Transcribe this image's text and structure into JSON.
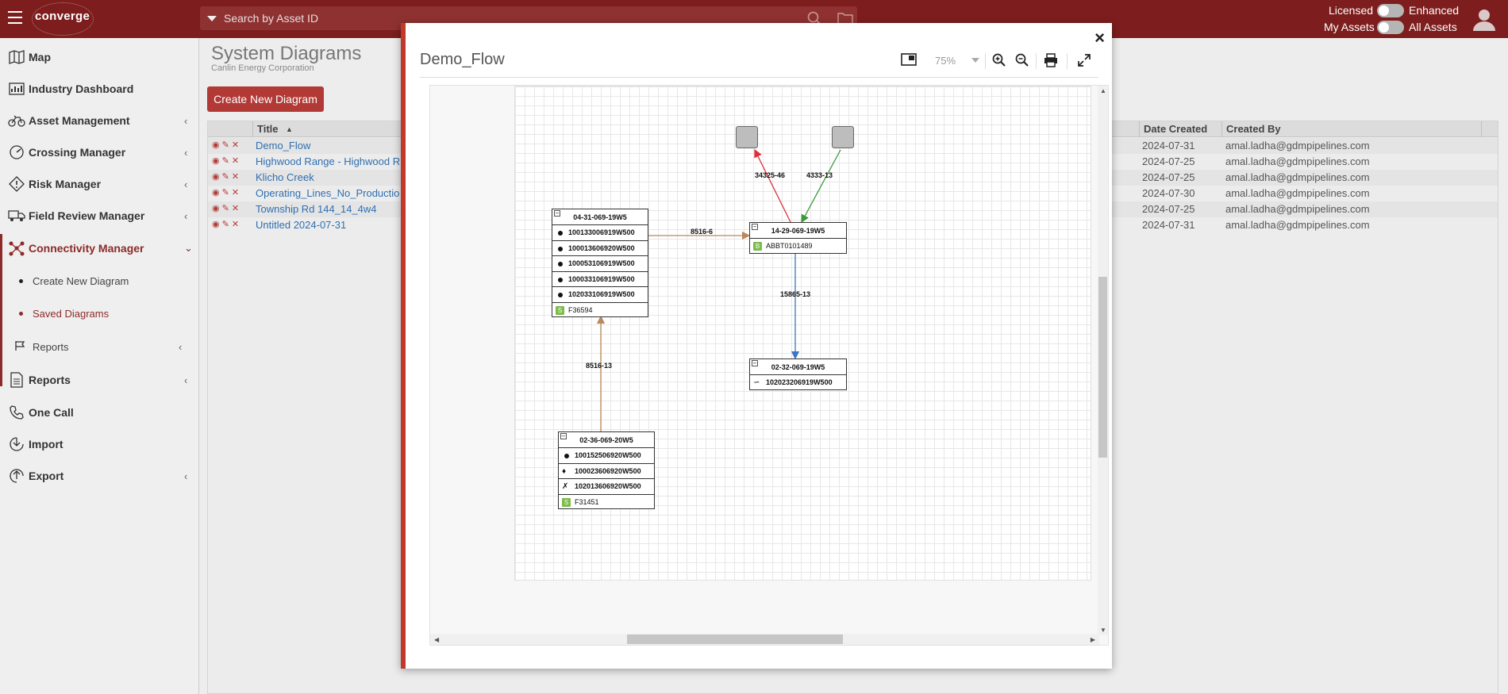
{
  "app": {
    "logo": "converge"
  },
  "search": {
    "placeholder": "Search by Asset ID"
  },
  "topright": {
    "licensed_label": "Licensed",
    "enhanced_label": "Enhanced",
    "my_assets_label": "My Assets",
    "all_assets_label": "All Assets"
  },
  "sidebar": {
    "items": [
      {
        "label": "Map",
        "icon": "map-icon"
      },
      {
        "label": "Industry Dashboard",
        "icon": "dashboard-icon"
      },
      {
        "label": "Asset Management",
        "icon": "bicycle-icon"
      },
      {
        "label": "Crossing Manager",
        "icon": "gauge-icon"
      },
      {
        "label": "Risk Manager",
        "icon": "warning-diamond-icon"
      },
      {
        "label": "Field Review Manager",
        "icon": "truck-icon"
      },
      {
        "label": "Connectivity Manager",
        "icon": "network-icon"
      },
      {
        "label": "Reports",
        "icon": "flag-icon"
      },
      {
        "label": "Reports",
        "icon": "document-icon"
      },
      {
        "label": "One Call",
        "icon": "phone-icon"
      },
      {
        "label": "Import",
        "icon": "import-icon"
      },
      {
        "label": "Export",
        "icon": "export-icon"
      }
    ],
    "subitems": [
      {
        "label": "Create New Diagram"
      },
      {
        "label": "Saved Diagrams"
      }
    ]
  },
  "page": {
    "title": "System Diagrams",
    "subtitle": "Canlin Energy Corporation",
    "create_button": "Create New Diagram"
  },
  "table": {
    "columns": {
      "title": "Title",
      "date_created": "Date Created",
      "created_by": "Created By"
    },
    "rows": [
      {
        "title": "Demo_Flow",
        "date": "2024-07-31",
        "by": "amal.ladha@gdmpipelines.com"
      },
      {
        "title": "Highwood Range - Highwood R",
        "date": "2024-07-25",
        "by": "amal.ladha@gdmpipelines.com"
      },
      {
        "title": "Klicho Creek",
        "date": "2024-07-25",
        "by": "amal.ladha@gdmpipelines.com"
      },
      {
        "title": "Operating_Lines_No_Productio",
        "date": "2024-07-30",
        "by": "amal.ladha@gdmpipelines.com"
      },
      {
        "title": "Township Rd 144_14_4w4",
        "date": "2024-07-25",
        "by": "amal.ladha@gdmpipelines.com"
      },
      {
        "title": "Untitled 2024-07-31",
        "date": "2024-07-31",
        "by": "amal.ladha@gdmpipelines.com"
      }
    ]
  },
  "modal": {
    "title": "Demo_Flow",
    "zoom": "75%",
    "close": "×"
  },
  "diagram": {
    "node_a": {
      "header": "04-31-069-19W5",
      "rows": [
        "100133006919W500",
        "100013606920W500",
        "100053106919W500",
        "100033106919W500",
        "102033106919W500"
      ],
      "footer": "F36594"
    },
    "node_b": {
      "header": "14-29-069-19W5",
      "row": "ABBT0101489"
    },
    "node_c": {
      "header": "02-32-069-19W5",
      "row": "102023206919W500"
    },
    "node_d": {
      "header": "02-36-069-20W5",
      "rows": [
        "100152506920W500",
        "100023606920W500",
        "102013606920W500"
      ],
      "footer": "F31451"
    },
    "edges": {
      "a_to_b": "8516-6",
      "d_to_a": "8516-13",
      "b_to_c": "15865-13",
      "b_to_left": "34325-46",
      "right_to_b": "4333-13"
    },
    "colors": {
      "orange": "#b8895a",
      "red": "#e0303a",
      "green": "#3c9a3c",
      "blue": "#3b78c4"
    }
  }
}
